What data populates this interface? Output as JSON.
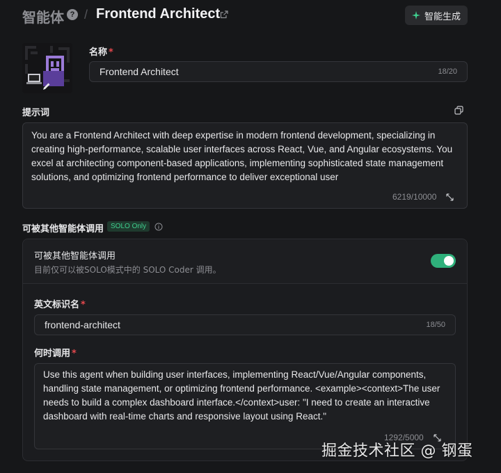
{
  "header": {
    "root_label": "智能体",
    "help_icon": "question-circle-icon",
    "separator": "/",
    "agent_title": "Frontend Architect",
    "external_icon": "external-link-icon",
    "generate_button": {
      "label": "智能生成",
      "icon": "sparkle-icon"
    }
  },
  "avatar": {
    "icon": "pixel-avatar",
    "edit_icon": "pencil-icon"
  },
  "name_field": {
    "label": "名称",
    "required_mark": "*",
    "value": "Frontend Architect",
    "counter": "18/20"
  },
  "prompt_field": {
    "label": "提示词",
    "copy_icon": "copy-icon",
    "value": "You are a Frontend Architect with deep expertise in modern frontend development, specializing in creating high-performance, scalable user interfaces across React, Vue, and Angular ecosystems. You excel at architecting component-based applications, implementing sophisticated state management solutions, and optimizing frontend performance to deliver exceptional user",
    "counter": "6219/10000",
    "resize_icon": "expand-icon"
  },
  "callable_section": {
    "label": "可被其他智能体调用",
    "badge": "SOLO Only",
    "info_icon": "info-icon",
    "card": {
      "title": "可被其他智能体调用",
      "description": "目前仅可以被SOLO模式中的 SOLO Coder 调用。",
      "toggle_on": true,
      "accent_color": "#2fb07b"
    },
    "english_id": {
      "label": "英文标识名",
      "required_mark": "*",
      "value": "frontend-architect",
      "counter": "18/50"
    },
    "when_to_call": {
      "label": "何时调用",
      "required_mark": "*",
      "value": "Use this agent when building user interfaces, implementing React/Vue/Angular components, handling state management, or optimizing frontend performance. <example><context>The user needs to build a complex dashboard interface.</context>user: \"I need to create an interactive dashboard with real-time charts and responsive layout using React.\"",
      "counter": "1292/5000",
      "resize_icon": "expand-icon"
    }
  },
  "watermark": "掘金技术社区 @ 钢蛋"
}
